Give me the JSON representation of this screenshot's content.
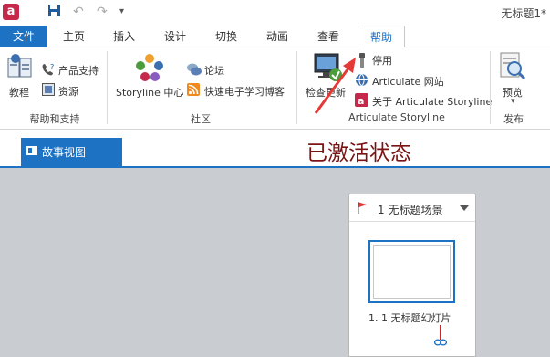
{
  "titlebar": {
    "app_icon_letter": "a",
    "doc_title": "无标题1*"
  },
  "tabs": {
    "file": "文件",
    "home": "主页",
    "insert": "插入",
    "design": "设计",
    "transitions": "切换",
    "animations": "动画",
    "view": "查看",
    "help": "帮助"
  },
  "ribbon": {
    "help_support": {
      "tutorials": "教程",
      "product_support": "产品支持",
      "resources": "资源",
      "group_label": "帮助和支持"
    },
    "community": {
      "storyline_center": "Storyline 中心",
      "forums": "论坛",
      "elearning_blog": "快速电子学习博客",
      "group_label": "社区"
    },
    "articulate_storyline": {
      "check_updates": "检查更新",
      "deactivate": "停用",
      "articulate_website": "Articulate 网站",
      "about": "关于 Articulate Storyline",
      "group_label": "Articulate Storyline"
    },
    "publish": {
      "preview": "预览",
      "group_label": "发布"
    }
  },
  "view_tab": {
    "label": "故事视图"
  },
  "annotation": "已激活状态",
  "scene": {
    "title": "1 无标题场景",
    "slide_label": "1. 1 无标题幻灯片"
  },
  "colors": {
    "accent": "#1d72c4",
    "annotation": "#7a1414",
    "arrow": "#e53935",
    "canvas": "#c9ccd1"
  }
}
